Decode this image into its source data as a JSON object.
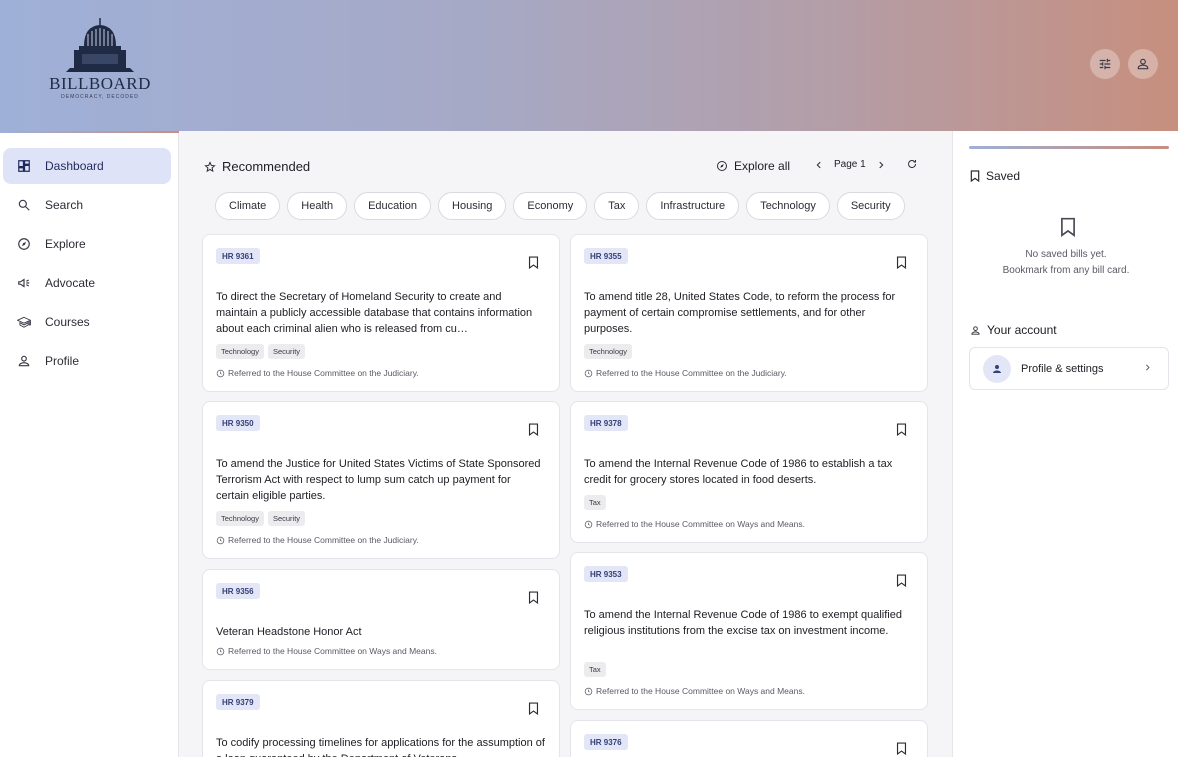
{
  "app": {
    "logo_text": "BILLBOARD",
    "logo_tagline": "DEMOCRACY, DECODED"
  },
  "header": {
    "icons": [
      "tune-icon",
      "person-icon"
    ]
  },
  "sidebar": {
    "items": [
      {
        "label": "Dashboard",
        "icon": "dashboard-icon",
        "active": true
      },
      {
        "label": "Search",
        "icon": "search-icon"
      },
      {
        "label": "Explore",
        "icon": "compass-icon"
      },
      {
        "label": "Advocate",
        "icon": "megaphone-icon"
      },
      {
        "label": "Courses",
        "icon": "school-icon"
      },
      {
        "label": "Profile",
        "icon": "person-icon"
      }
    ]
  },
  "main": {
    "title": "Recommended",
    "explore_all": "Explore all",
    "page_label": "Page 1",
    "chips": [
      "Climate",
      "Health",
      "Education",
      "Housing",
      "Economy",
      "Tax",
      "Infrastructure",
      "Technology",
      "Security"
    ],
    "bills": [
      {
        "id": "HR 9361",
        "title": "To direct the Secretary of Homeland Security to create and maintain a publicly accessible database that contains information about each criminal alien who is released from cu…",
        "tags": [
          "Technology",
          "Security"
        ],
        "status": "Referred to the House Committee on the Judiciary."
      },
      {
        "id": "HR 9355",
        "title": "To amend title 28, United States Code, to reform the process for payment of certain compromise settlements, and for other purposes.",
        "tags": [
          "Technology"
        ],
        "status": "Referred to the House Committee on the Judiciary."
      },
      {
        "id": "HR 9350",
        "title": "To amend the Justice for United States Victims of State Sponsored Terrorism Act with respect to lump sum catch up payment for certain eligible parties.",
        "tags": [
          "Technology",
          "Security"
        ],
        "status": "Referred to the House Committee on the Judiciary."
      },
      {
        "id": "HR 9378",
        "title": "To amend the Internal Revenue Code of 1986 to establish a tax credit for grocery stores located in food deserts.",
        "tags": [
          "Tax"
        ],
        "status": "Referred to the House Committee on Ways and Means."
      },
      {
        "id": "HR 9356",
        "title": "Veteran Headstone Honor Act",
        "tags": [],
        "status": "Referred to the House Committee on Ways and Means."
      },
      {
        "id": "HR 9353",
        "title": "To amend the Internal Revenue Code of 1986 to exempt qualified religious institutions from the excise tax on investment income.",
        "tags": [
          "Tax"
        ],
        "status": "Referred to the House Committee on Ways and Means."
      },
      {
        "id": "HR 9379",
        "title": "To codify processing timelines for applications for the assumption of a loan guaranteed by the Department of Veterans",
        "tags": [],
        "status": ""
      },
      {
        "id": "HR 9376",
        "title": "",
        "tags": [],
        "status": ""
      }
    ]
  },
  "right_panel": {
    "saved_title": "Saved",
    "empty_line1": "No saved bills yet.",
    "empty_line2": "Bookmark from any bill card.",
    "account_title": "Your account",
    "account_item": "Profile & settings"
  },
  "colors": {
    "accent": "#dfe3f7",
    "badge_bg": "#e2e6f6",
    "badge_text": "#34407a",
    "header_gradient_start": "#9fb0d8",
    "header_gradient_end": "#c78f7e"
  }
}
